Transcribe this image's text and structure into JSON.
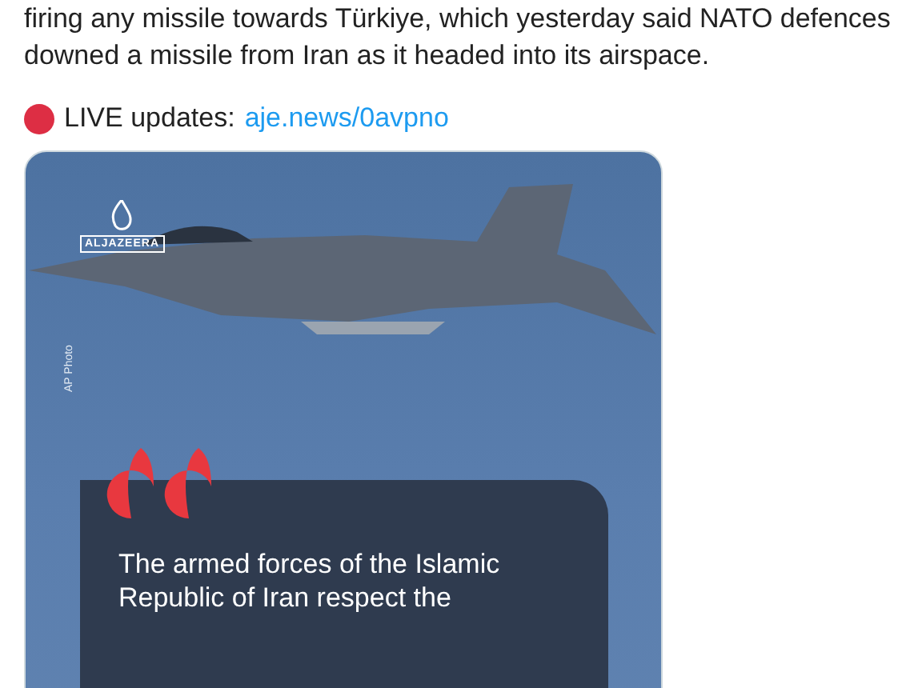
{
  "post": {
    "text": "firing any missile towards Türkiye, which yesterday said NATO defences downed a missile from Iran as it headed into its airspace.",
    "live": {
      "label": "LIVE updates:",
      "link": "aje.news/0avpno"
    },
    "media": {
      "logo": "ALJAZEERA",
      "credit": "AP Photo",
      "quote": "The armed forces of the Islamic Republic of Iran respect the"
    }
  }
}
